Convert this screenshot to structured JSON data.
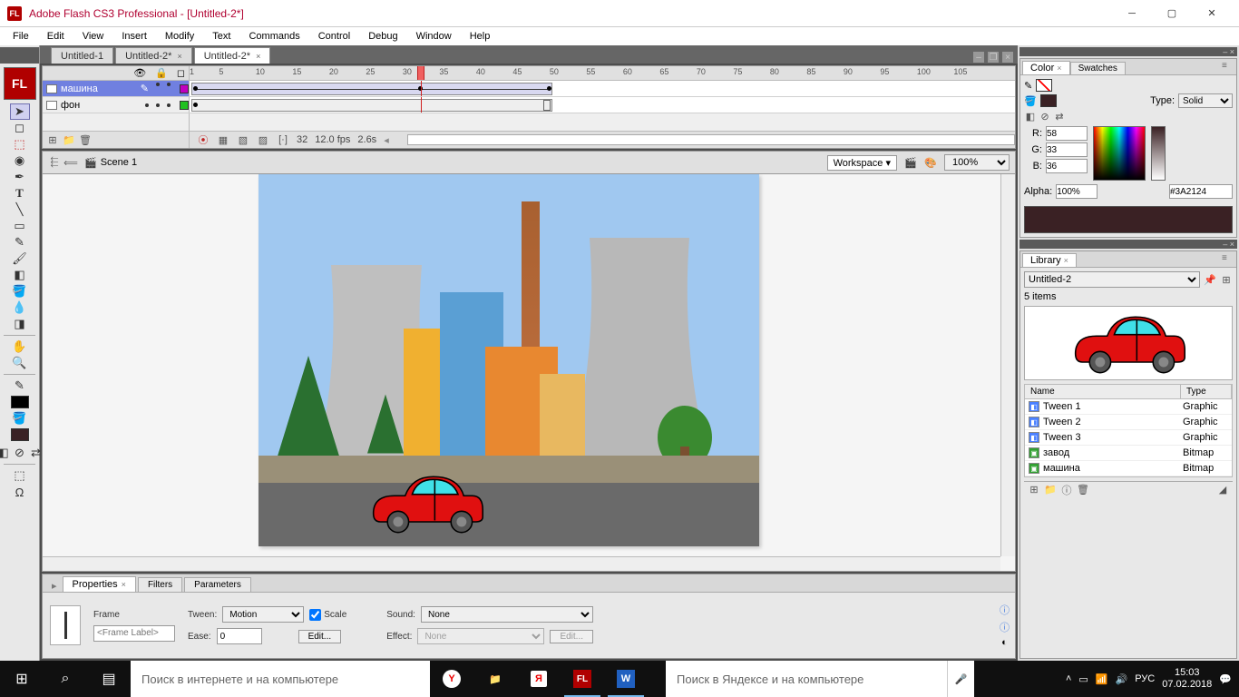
{
  "window": {
    "app_icon_text": "FL",
    "title": "Adobe Flash CS3 Professional - [Untitled-2*]"
  },
  "menu": [
    "File",
    "Edit",
    "View",
    "Insert",
    "Modify",
    "Text",
    "Commands",
    "Control",
    "Debug",
    "Window",
    "Help"
  ],
  "doc_tabs": [
    {
      "label": "Untitled-1",
      "active": false,
      "dirty": false
    },
    {
      "label": "Untitled-2*",
      "active": false,
      "dirty": true
    },
    {
      "label": "Untitled-2*",
      "active": true,
      "dirty": true
    }
  ],
  "timeline": {
    "layers": [
      {
        "name": "машина",
        "selected": true,
        "color": "#c000c0"
      },
      {
        "name": "фон",
        "selected": false,
        "color": "#20c020"
      }
    ],
    "ruler_marks": [
      1,
      5,
      10,
      15,
      20,
      25,
      30,
      35,
      40,
      45,
      50,
      55,
      60,
      65,
      70,
      75,
      80,
      85,
      90,
      95,
      100,
      105
    ],
    "playhead_frame": 32,
    "current_frame": "32",
    "fps": "12.0 fps",
    "elapsed": "2.6s"
  },
  "scene": {
    "name": "Scene 1",
    "workspace_label": "Workspace ▾",
    "zoom": "100%"
  },
  "properties": {
    "tabs": [
      "Properties",
      "Filters",
      "Parameters"
    ],
    "frame_label_placeholder": "<Frame Label>",
    "frame_label_title": "Frame",
    "tween_label": "Tween:",
    "tween_value": "Motion",
    "scale_label": "Scale",
    "ease_label": "Ease:",
    "ease_value": "0",
    "edit_btn": "Edit...",
    "sound_label": "Sound:",
    "sound_value": "None",
    "effect_label": "Effect:",
    "effect_value": "None",
    "effect_edit": "Edit..."
  },
  "color_panel": {
    "tabs": [
      "Color",
      "Swatches"
    ],
    "type_label": "Type:",
    "type_value": "Solid",
    "r_label": "R:",
    "r_value": "58",
    "g_label": "G:",
    "g_value": "33",
    "b_label": "B:",
    "b_value": "36",
    "alpha_label": "Alpha:",
    "alpha_value": "100%",
    "hex_value": "#3A2124"
  },
  "library_panel": {
    "tab": "Library",
    "doc": "Untitled-2",
    "count": "5 items",
    "columns": {
      "name": "Name",
      "type": "Type"
    },
    "rows": [
      {
        "icon": "◧",
        "icon_bg": "#4a80ff",
        "name": "Tween 1",
        "type": "Graphic"
      },
      {
        "icon": "◧",
        "icon_bg": "#4a80ff",
        "name": "Tween 2",
        "type": "Graphic"
      },
      {
        "icon": "◧",
        "icon_bg": "#4a80ff",
        "name": "Tween 3",
        "type": "Graphic"
      },
      {
        "icon": "▣",
        "icon_bg": "#30a030",
        "name": "завод",
        "type": "Bitmap"
      },
      {
        "icon": "▣",
        "icon_bg": "#30a030",
        "name": "машина",
        "type": "Bitmap"
      }
    ]
  },
  "taskbar": {
    "search_placeholder": "Поиск в интернете и на компьютере",
    "yandex_placeholder": "Поиск в Яндексе и на компьютере",
    "lang": "РУС",
    "time": "15:03",
    "date": "07.02.2018"
  }
}
